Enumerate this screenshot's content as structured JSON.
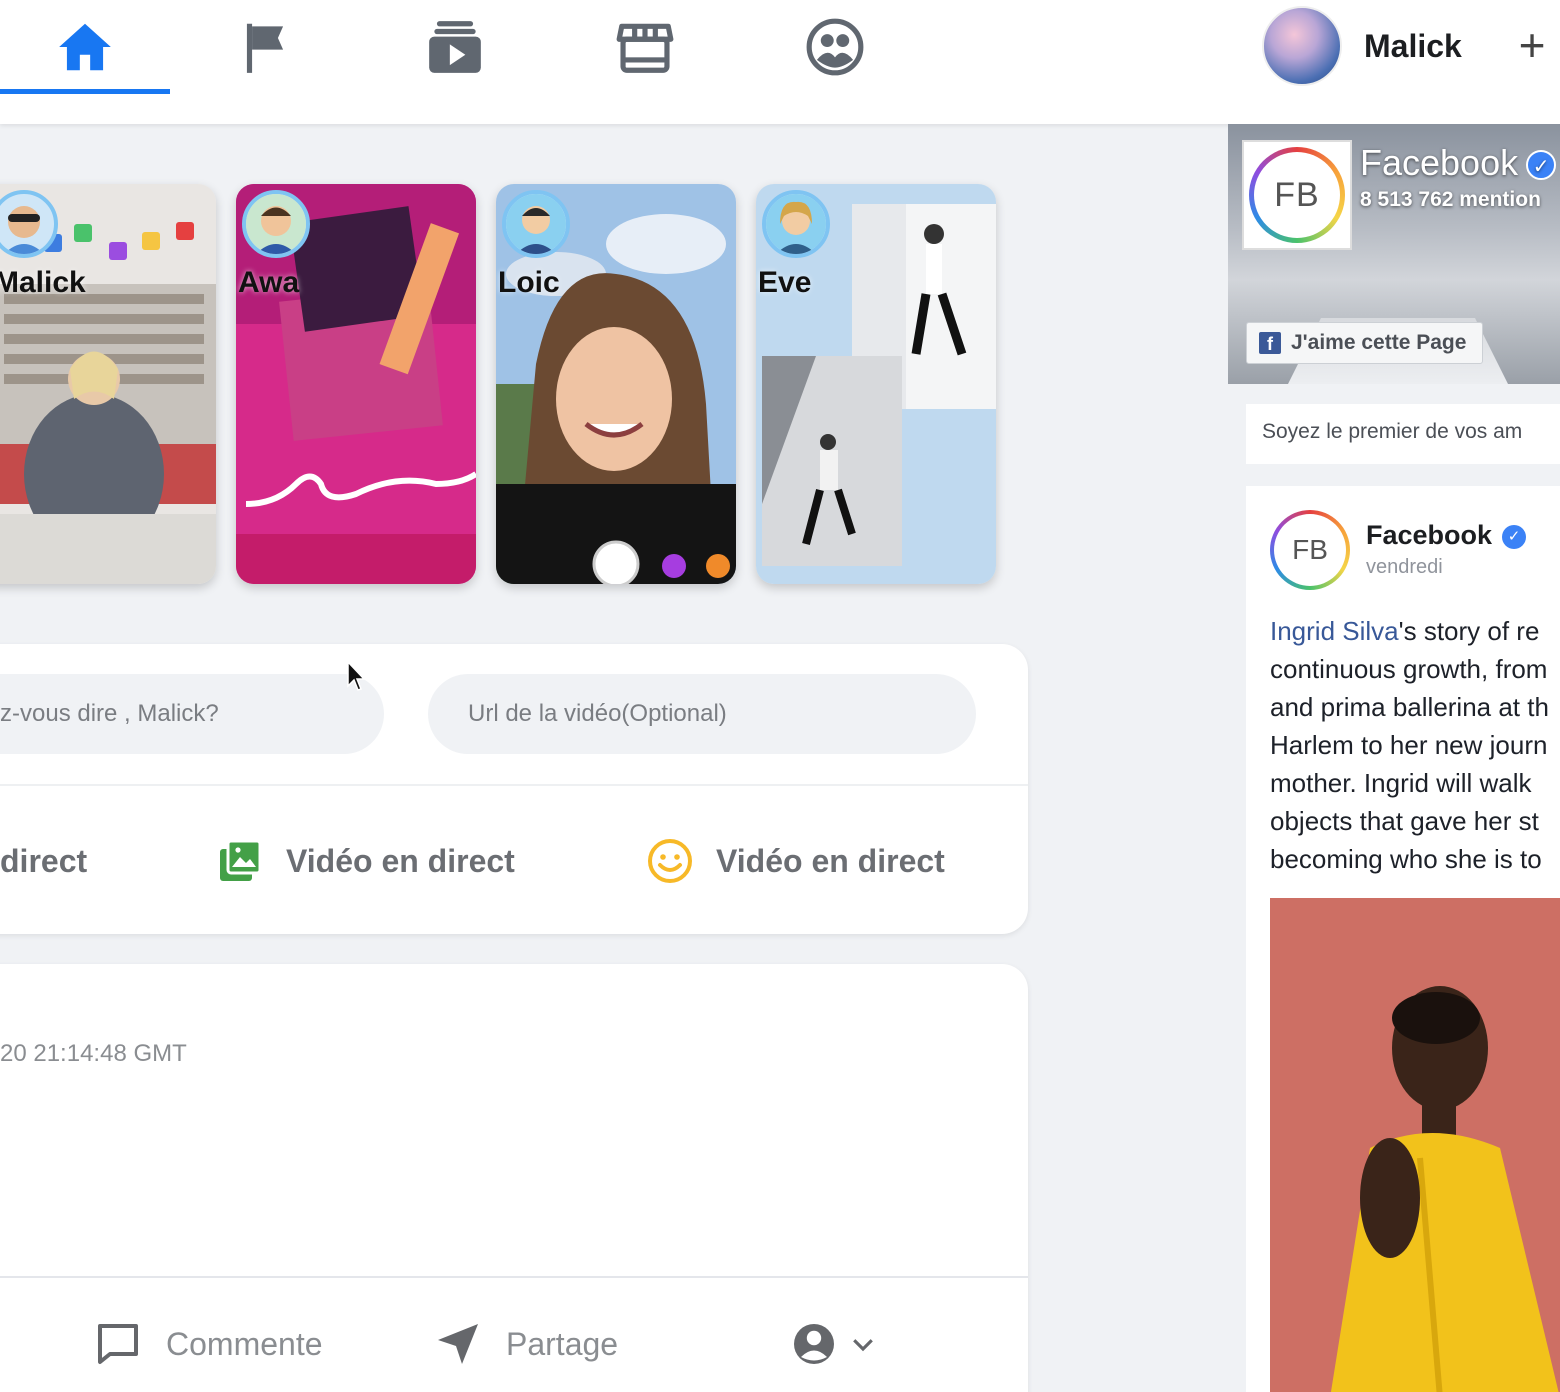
{
  "nav": {
    "tabs": [
      {
        "name": "home",
        "icon": "home-icon",
        "active": true
      },
      {
        "name": "pages",
        "icon": "flag-icon",
        "active": false
      },
      {
        "name": "watch",
        "icon": "video-play-icon",
        "active": false
      },
      {
        "name": "marketplace",
        "icon": "store-icon",
        "active": false
      },
      {
        "name": "groups",
        "icon": "groups-icon",
        "active": false
      }
    ],
    "user_name": "Malick",
    "plus_label": "+"
  },
  "colors": {
    "accent": "#1877f2",
    "background": "#f0f2f5",
    "photo_green": "#43a047",
    "emoji_orange": "#f7b928"
  },
  "stories": [
    {
      "name": "Malick"
    },
    {
      "name": "Awa"
    },
    {
      "name": "Loic"
    },
    {
      "name": "Eve"
    }
  ],
  "composer": {
    "text_placeholder": "z-vous dire , Malick?",
    "video_placeholder": "Url de la vidéo(Optional)",
    "actions": [
      {
        "label": "direct",
        "icon": "live-video-icon"
      },
      {
        "label": "Vidéo en direct",
        "icon": "photo-icon"
      },
      {
        "label": "Vidéo en direct",
        "icon": "smiley-icon"
      }
    ]
  },
  "post": {
    "timestamp": "20 21:14:48 GMT",
    "comment_label": "Commente",
    "share_label": "Partage"
  },
  "sidebar": {
    "page_widget": {
      "name": "Facebook",
      "mentions": "8 513 762 mention",
      "logo_text": "FB",
      "like_button": "J'aime cette Page",
      "friends_text": "Soyez le premier de vos am"
    },
    "post": {
      "author": "Facebook",
      "day": "vendredi",
      "logo_text": "FB",
      "link_text": "Ingrid Silva",
      "lines": [
        "'s story of re",
        "continuous growth, from",
        "and prima ballerina at th",
        "Harlem to her new journ",
        "mother. Ingrid will walk",
        "objects that gave her st",
        "becoming who she is to"
      ]
    }
  }
}
